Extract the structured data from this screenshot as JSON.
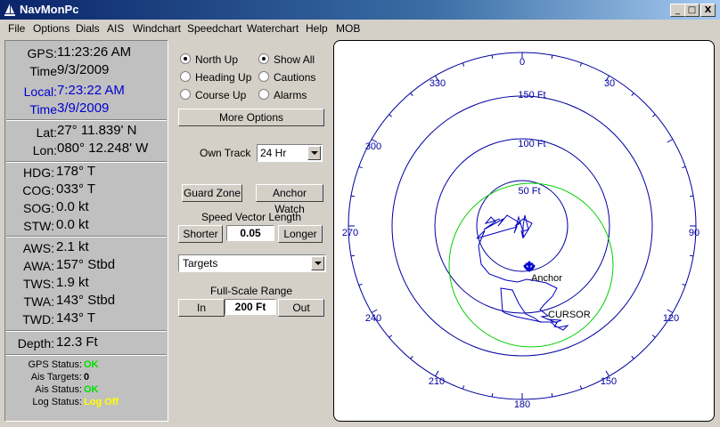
{
  "window": {
    "title": "NavMonPc",
    "min_label": "_",
    "max_label": "□",
    "close_label": "X"
  },
  "menu": [
    "File",
    "Options",
    "Dials",
    "AIS",
    "Windchart",
    "Speedchart",
    "Waterchart",
    "Help",
    "MOB"
  ],
  "time": {
    "gps_label": "GPS:",
    "gps_time": "11:23:26 AM",
    "time_label": "Time",
    "gps_date": "9/3/2009",
    "local_label": "Local:",
    "local_time": "7:23:22 AM",
    "local_time_label": "Time",
    "local_date": "3/9/2009"
  },
  "position": {
    "lat_label": "Lat:",
    "lat": "27° 11.839' N",
    "lon_label": "Lon:",
    "lon": "080° 12.248' W"
  },
  "motion": {
    "hdg_label": "HDG:",
    "hdg": "178° T",
    "cog_label": "COG:",
    "cog": "033° T",
    "sog_label": "SOG:",
    "sog": "0.0 kt",
    "stw_label": "STW:",
    "stw": "0.0 kt"
  },
  "wind": {
    "aws_label": "AWS:",
    "aws": "2.1 kt",
    "awa_label": "AWA:",
    "awa": "157° Stbd",
    "tws_label": "TWS:",
    "tws": "1.9 kt",
    "twa_label": "TWA:",
    "twa": "143° Stbd",
    "twd_label": "TWD:",
    "twd": "143° T"
  },
  "depth": {
    "label": "Depth:",
    "value": "12.3 Ft"
  },
  "status": {
    "gps_label": "GPS Status:",
    "gps": "OK",
    "ais_targets_label": "Ais Targets:",
    "ais_targets": "0",
    "ais_label": "Ais Status:",
    "ais": "OK",
    "log_label": "Log Status:",
    "log": "Log Off",
    "ok_color": "#00e000",
    "warn_color": "#ffff00"
  },
  "controls": {
    "north_up": "North Up",
    "heading_up": "Heading Up",
    "course_up": "Course Up",
    "show_all": "Show All",
    "cautions": "Cautions",
    "alarms": "Alarms",
    "more_options": "More Options",
    "own_track_label": "Own Track",
    "own_track_value": "24 Hr",
    "guard_zone": "Guard Zone",
    "anchor_watch": "Anchor Watch",
    "speed_vector_label": "Speed Vector Length",
    "shorter": "Shorter",
    "speed_vector_value": "0.05",
    "longer": "Longer",
    "targets_value": "Targets",
    "range_label": "Full-Scale Range",
    "zoom_in": "In",
    "range_value": "200 Ft",
    "zoom_out": "Out"
  },
  "radar": {
    "bearings": [
      "0",
      "30",
      "90",
      "120",
      "150",
      "180",
      "210",
      "240",
      "270",
      "300",
      "330"
    ],
    "ring_labels": [
      "150 Ft",
      "100 Ft",
      "50 Ft"
    ],
    "anchor_label": "Anchor",
    "cursor_label": "CURSOR",
    "ring_color": "#0000a0",
    "guard_color": "#00d000",
    "track_color": "#0000c0"
  }
}
